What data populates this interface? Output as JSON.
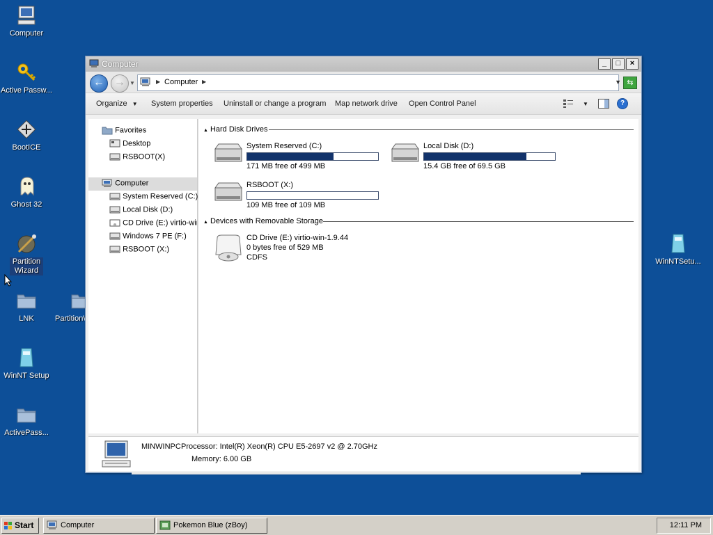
{
  "desktop": {
    "icons": [
      {
        "label": "Computer"
      },
      {
        "label": "Active Passw..."
      },
      {
        "label": "BootICE"
      },
      {
        "label": "Ghost 32"
      },
      {
        "label": "Partition Wizard"
      },
      {
        "label": "LNK"
      },
      {
        "label": "PartitionW"
      },
      {
        "label": "WinNT Setup"
      },
      {
        "label": "ActivePass..."
      },
      {
        "label": "WinNTSetu..."
      }
    ]
  },
  "window": {
    "title": "Computer",
    "buttons": {
      "minimize": "_",
      "maximize": "□",
      "close": "×"
    },
    "address": {
      "location": "Computer"
    },
    "toolbar": {
      "organize": "Organize",
      "system_properties": "System properties",
      "uninstall": "Uninstall or change a program",
      "map_network": "Map network drive",
      "control_panel": "Open Control Panel"
    },
    "nav": {
      "favorites": "Favorites",
      "desktop": "Desktop",
      "rsboot_fav": "RSBOOT(X)",
      "computer": "Computer",
      "drives": [
        {
          "label": "System Reserved (C:)"
        },
        {
          "label": "Local Disk (D:)"
        },
        {
          "label": "CD Drive (E:) virtio-win"
        },
        {
          "label": "Windows 7 PE (F:)"
        },
        {
          "label": "RSBOOT (X:)"
        }
      ]
    },
    "content": {
      "hard_disk_header": "Hard Disk Drives",
      "removable_header": "Devices with Removable Storage",
      "hard_disks": [
        {
          "name": "System Reserved (C:)",
          "free_text": "171 MB free of 499 MB",
          "used_fraction": 0.66
        },
        {
          "name": "Local Disk (D:)",
          "free_text": "15.4 GB free of 69.5 GB",
          "used_fraction": 0.78
        },
        {
          "name": "RSBOOT (X:)",
          "free_text": "109 MB free of 109 MB",
          "used_fraction": 0.0
        }
      ],
      "removable": {
        "name": "CD Drive (E:) virtio-win-1.9.44",
        "free_text": "0 bytes free of 529 MB",
        "fs": "CDFS"
      }
    },
    "details": {
      "pc_name": "MINWINPC",
      "processor": "Processor: Intel(R) Xeon(R) CPU E5-2697 v2 @ 2.70GHz",
      "memory": "Memory: 6.00 GB"
    }
  },
  "taskbar": {
    "start": "Start",
    "items": [
      {
        "label": "Computer"
      },
      {
        "label": "Pokemon Blue (zBoy)"
      }
    ],
    "clock": "12:11 PM"
  }
}
